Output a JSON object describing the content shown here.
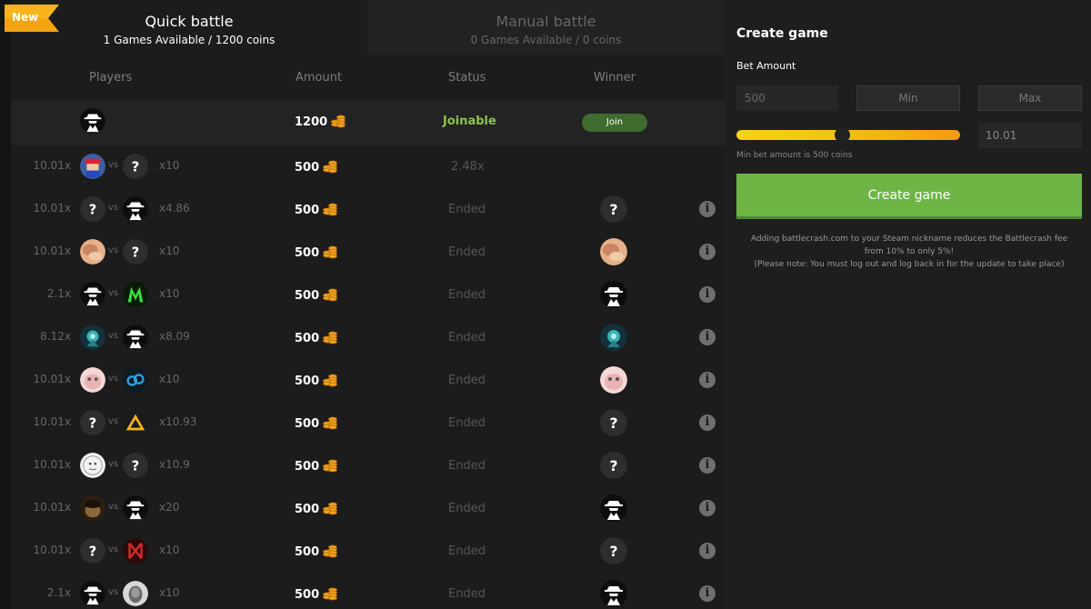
{
  "tabs": {
    "quick": {
      "title": "Quick battle",
      "sub": "1 Games Available / 1200 coins"
    },
    "manual": {
      "title": "Manual battle",
      "sub": "0 Games Available / 0 coins"
    }
  },
  "badge_new": "New",
  "table": {
    "headers": {
      "players": "Players",
      "amount": "Amount",
      "status": "Status",
      "winner": "Winner"
    },
    "rows": [
      {
        "left_mult": "",
        "p1": "spy",
        "p2": "",
        "right_mult": "",
        "amount": "1200",
        "status": "Joinable",
        "winner": "join",
        "join_label": "Join"
      },
      {
        "left_mult": "10.01x",
        "p1": "mario",
        "p2": "question",
        "right_mult": "x10",
        "amount": "500",
        "status": "2.48x",
        "winner": "",
        "join_label": ""
      },
      {
        "left_mult": "10.01x",
        "p1": "question",
        "p2": "spy",
        "right_mult": "x4.86",
        "amount": "500",
        "status": "Ended",
        "winner": "question",
        "join_label": ""
      },
      {
        "left_mult": "10.01x",
        "p1": "face",
        "p2": "question",
        "right_mult": "x10",
        "amount": "500",
        "status": "Ended",
        "winner": "face",
        "join_label": ""
      },
      {
        "left_mult": "2.1x",
        "p1": "spy",
        "p2": "green",
        "right_mult": "x10",
        "amount": "500",
        "status": "Ended",
        "winner": "spy",
        "join_label": ""
      },
      {
        "left_mult": "8.12x",
        "p1": "teal",
        "p2": "spy",
        "right_mult": "x8.09",
        "amount": "500",
        "status": "Ended",
        "winner": "teal",
        "join_label": ""
      },
      {
        "left_mult": "10.01x",
        "p1": "pink",
        "p2": "cloud9",
        "right_mult": "x10",
        "amount": "500",
        "status": "Ended",
        "winner": "pink",
        "join_label": ""
      },
      {
        "left_mult": "10.01x",
        "p1": "question",
        "p2": "triangle",
        "right_mult": "x10.93",
        "amount": "500",
        "status": "Ended",
        "winner": "question",
        "join_label": ""
      },
      {
        "left_mult": "10.01x",
        "p1": "white",
        "p2": "question",
        "right_mult": "x10.9",
        "amount": "500",
        "status": "Ended",
        "winner": "question",
        "join_label": ""
      },
      {
        "left_mult": "10.01x",
        "p1": "dark",
        "p2": "spy",
        "right_mult": "x20",
        "amount": "500",
        "status": "Ended",
        "winner": "spy",
        "join_label": ""
      },
      {
        "left_mult": "10.01x",
        "p1": "question",
        "p2": "redlogo",
        "right_mult": "x10",
        "amount": "500",
        "status": "Ended",
        "winner": "question",
        "join_label": ""
      },
      {
        "left_mult": "2.1x",
        "p1": "spy",
        "p2": "gray",
        "right_mult": "x10",
        "amount": "500",
        "status": "Ended",
        "winner": "spy",
        "join_label": ""
      }
    ]
  },
  "create": {
    "title": "Create game",
    "bet_label": "Bet Amount",
    "bet_value": "500",
    "min_label": "Min",
    "max_label": "Max",
    "multiplier": "10.01",
    "slider_fraction": 0.47,
    "hint": "Min bet amount is 500 coins",
    "button": "Create game",
    "note_line1": "Adding battlecrash.com to your Steam nickname reduces the Battlecrash fee from 10% to only 5%!",
    "note_line2": "(Please note: You must log out and log back in for the update to take place)"
  },
  "colors": {
    "accent_green": "#6db646",
    "joinable": "#8bc34a",
    "slider_start": "#f7d117",
    "slider_end": "#f49b10",
    "ribbon": "#f2a30f"
  }
}
